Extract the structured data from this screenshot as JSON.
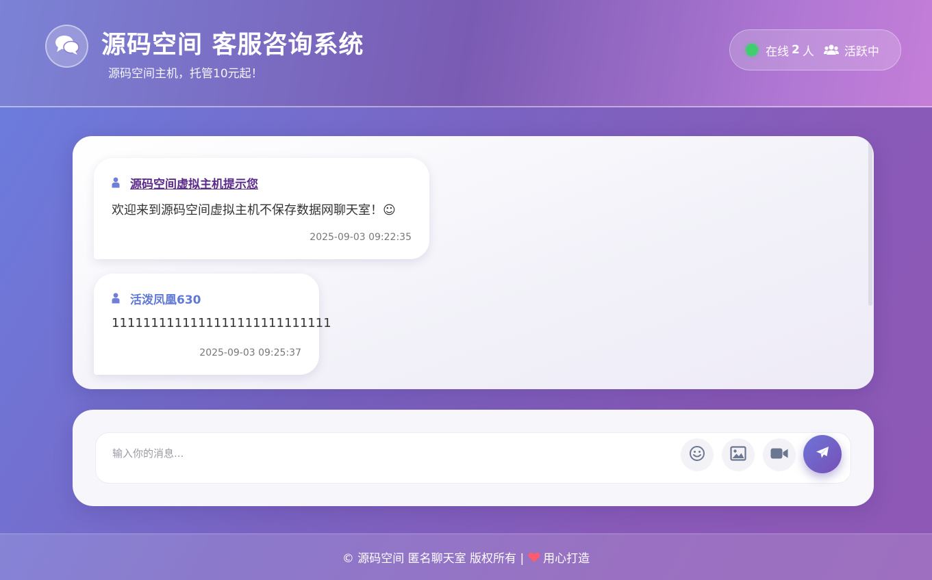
{
  "header": {
    "title": "源码空间 客服咨询系统",
    "subtitle": "源码空间主机，托管10元起！",
    "logo_icon": "comments-icon",
    "online_prefix": "在线",
    "online_count": "2",
    "online_suffix": "人",
    "activity_label": "活跃中",
    "status_color": "#3fcf6e"
  },
  "messages": [
    {
      "sender": "源码空间虚拟主机提示您",
      "text": "欢迎来到源码空间虚拟主机不保存数据网聊天室！☺",
      "time": "2025-09-03 09:22:35"
    },
    {
      "sender": "活泼凤凰630",
      "text": "1111111111111111111111111111",
      "time": "2025-09-03 09:25:37"
    }
  ],
  "composer": {
    "placeholder": "输入你的消息...",
    "value": ""
  },
  "footer": {
    "left_text": "© 源码空间 匿名聊天室 版权所有 |",
    "right_text": "用心打造"
  },
  "colors": {
    "accent": "#7650b6",
    "system_sender": "#5b2a8a",
    "user_sender": "#5f79d6",
    "heart": "#ff5a6e"
  }
}
